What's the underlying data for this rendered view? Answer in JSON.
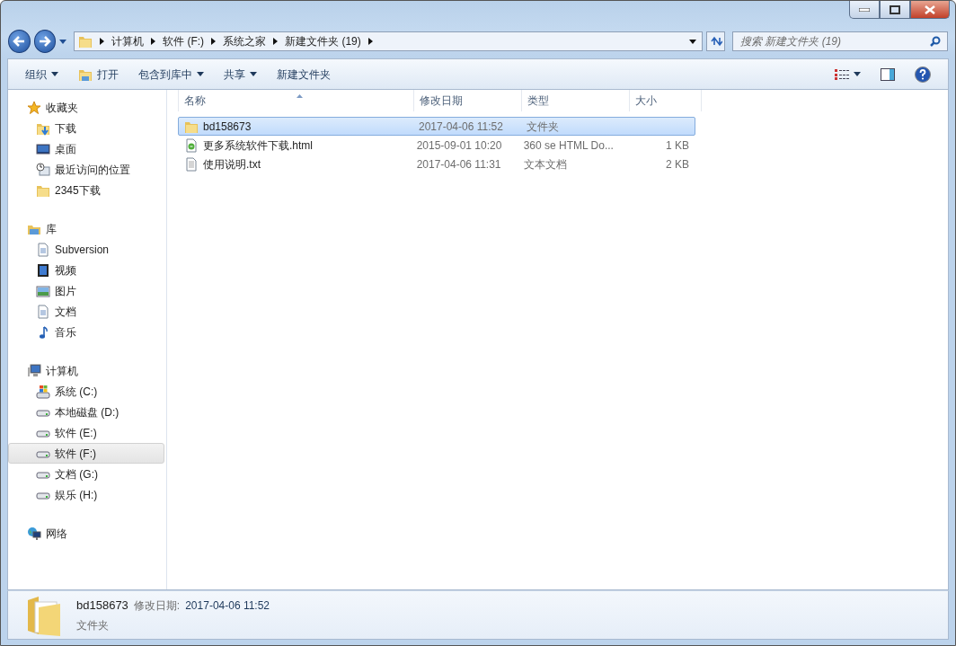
{
  "address_bar": {
    "breadcrumbs": [
      "计算机",
      "软件 (F:)",
      "系统之家",
      "新建文件夹 (19)"
    ]
  },
  "search": {
    "placeholder": "搜索 新建文件夹 (19)"
  },
  "toolbar": {
    "buttons": [
      {
        "label": "组织",
        "kind": "dropdown"
      },
      {
        "label": "打开",
        "kind": "open"
      },
      {
        "label": "包含到库中",
        "kind": "dropdown"
      },
      {
        "label": "共享",
        "kind": "dropdown"
      },
      {
        "label": "新建文件夹",
        "kind": "plain"
      }
    ]
  },
  "sidebar": {
    "groups": [
      {
        "label": "收藏夹",
        "kind": "star",
        "items": [
          {
            "label": "下载",
            "kind": "download",
            "selected": false
          },
          {
            "label": "桌面",
            "kind": "desktop",
            "selected": false
          },
          {
            "label": "最近访问的位置",
            "kind": "recent",
            "selected": false
          },
          {
            "label": "2345下载",
            "kind": "folder",
            "selected": false
          }
        ]
      },
      {
        "label": "库",
        "kind": "library",
        "items": [
          {
            "label": "Subversion",
            "kind": "document",
            "selected": false
          },
          {
            "label": "视频",
            "kind": "video",
            "selected": false
          },
          {
            "label": "图片",
            "kind": "image",
            "selected": false
          },
          {
            "label": "文档",
            "kind": "document",
            "selected": false
          },
          {
            "label": "音乐",
            "kind": "music",
            "selected": false
          }
        ]
      },
      {
        "label": "计算机",
        "kind": "computer",
        "items": [
          {
            "label": "系统 (C:)",
            "kind": "system-drive",
            "selected": false
          },
          {
            "label": "本地磁盘 (D:)",
            "kind": "drive",
            "selected": false
          },
          {
            "label": "软件 (E:)",
            "kind": "drive",
            "selected": false
          },
          {
            "label": "软件 (F:)",
            "kind": "drive",
            "selected": true
          },
          {
            "label": "文档 (G:)",
            "kind": "drive",
            "selected": false
          },
          {
            "label": "娱乐 (H:)",
            "kind": "drive",
            "selected": false
          }
        ]
      },
      {
        "label": "网络",
        "kind": "network"
      }
    ]
  },
  "table": {
    "columns": [
      {
        "label": "名称",
        "sorted": true
      },
      {
        "label": "修改日期",
        "sorted": false
      },
      {
        "label": "类型",
        "sorted": false
      },
      {
        "label": "大小",
        "sorted": false
      }
    ],
    "rows": [
      {
        "name": "bd158673",
        "modified": "2017-04-06 11:52",
        "type": "文件夹",
        "size": "",
        "kind": "folder",
        "selected": true
      },
      {
        "name": "更多系统软件下载.html",
        "modified": "2015-09-01 10:20",
        "type": "360 se HTML Do...",
        "size": "1 KB",
        "kind": "html",
        "selected": false
      },
      {
        "name": "使用说明.txt",
        "modified": "2017-04-06 11:31",
        "type": "文本文档",
        "size": "2 KB",
        "kind": "text",
        "selected": false
      }
    ]
  },
  "details_pane": {
    "name": "bd158673",
    "modified_label": "修改日期:",
    "modified_value": "2017-04-06 11:52",
    "type": "文件夹"
  }
}
